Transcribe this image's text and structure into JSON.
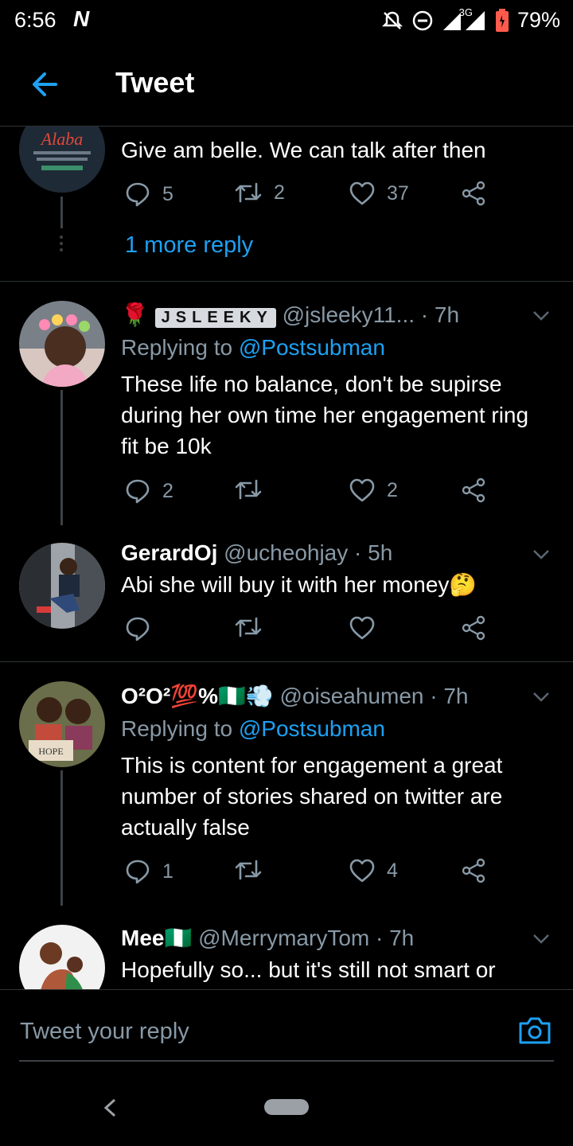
{
  "status": {
    "time": "6:56",
    "n_icon": "N",
    "network": "3G",
    "battery": "79%"
  },
  "header": {
    "title": "Tweet"
  },
  "tweets": [
    {
      "body": "Give am belle. We can talk after then",
      "replies": "5",
      "retweets": "2",
      "likes": "37",
      "more": "1 more reply"
    },
    {
      "name": "JSLEEKY",
      "handle": "@jsleeky11...",
      "time": "· 7h",
      "replying": "Replying to",
      "mention": "@Postsubman",
      "body": "These life no balance, don't be supirse during her own time her engagement ring fit be 10k",
      "replies": "2",
      "retweets": "",
      "likes": "2"
    },
    {
      "name": "GerardOj",
      "handle": "@ucheohjay",
      "time": "· 5h",
      "body": "Abi she will buy it with her money🤔",
      "replies": "",
      "retweets": "",
      "likes": ""
    },
    {
      "name": "O²O²💯%🇳🇬💨",
      "handle": "@oiseahumen",
      "time": "· 7h",
      "replying": "Replying to",
      "mention": "@Postsubman",
      "body": "This is content for engagement a great number of stories shared on twitter are actually false",
      "replies": "1",
      "retweets": "",
      "likes": "4"
    },
    {
      "name": "Mee🇳🇬",
      "handle": "@MerrymaryTom",
      "time": "· 7h",
      "body": "Hopefully so... but it's still not smart or"
    }
  ],
  "composer": {
    "placeholder": "Tweet your reply"
  },
  "icons": {
    "reply": "reply-icon",
    "retweet": "retweet-icon",
    "like": "heart-icon",
    "share": "share-icon",
    "back": "back-arrow-icon",
    "camera": "camera-icon",
    "caret": "chevron-down-icon"
  },
  "colors": {
    "accent": "#1da1f2",
    "muted": "#8899a6",
    "background": "#000000"
  }
}
